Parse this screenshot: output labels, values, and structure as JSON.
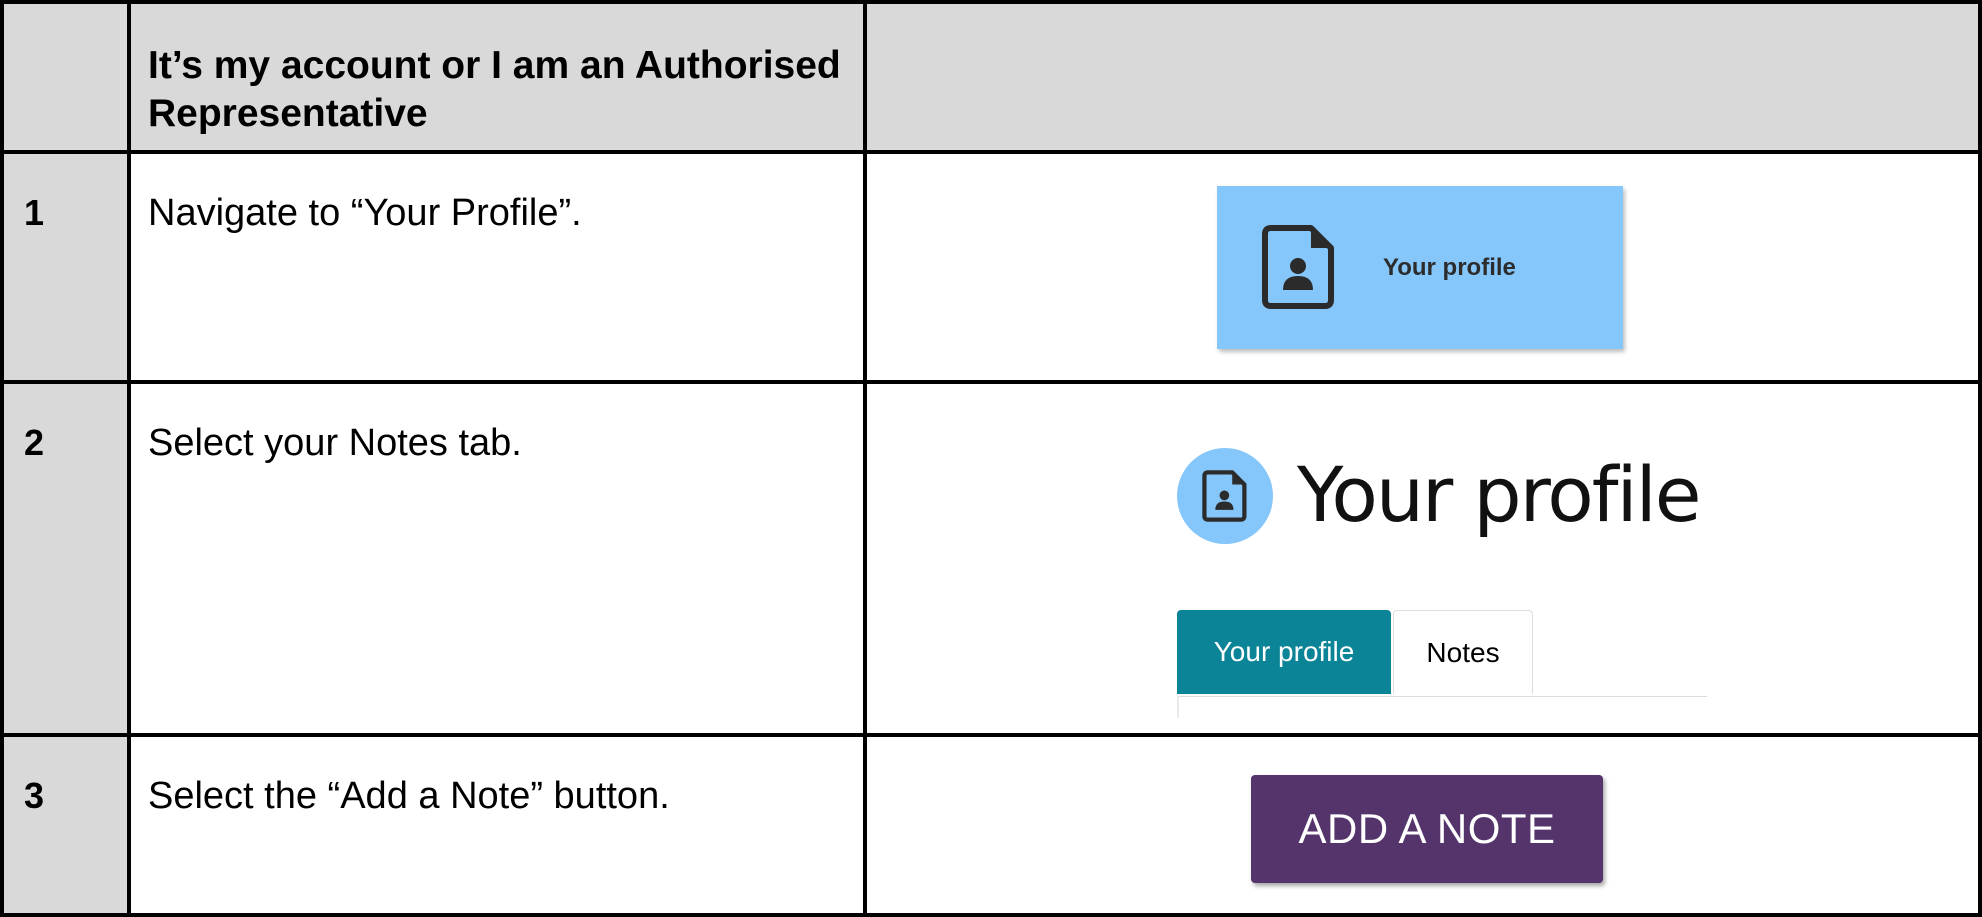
{
  "table": {
    "header": {
      "number": "",
      "instruction": "It’s my account or I am an Authorised Representative",
      "image": ""
    },
    "rows": [
      {
        "number": "1",
        "instruction": "Navigate to “Your Profile”.",
        "tile_label": "Your profile",
        "icon": "profile-document-icon"
      },
      {
        "number": "2",
        "instruction": "Select your Notes tab.",
        "page_title": "Your profile",
        "tabs": [
          "Your profile",
          "Notes"
        ],
        "active_tab": "Your profile",
        "icon": "profile-document-icon"
      },
      {
        "number": "3",
        "instruction": "Select the “Add a Note” button.",
        "button_label": "ADD A NOTE"
      }
    ]
  },
  "colors": {
    "header_gray": "#d9d9d9",
    "tile_blue": "#85c6fb",
    "tab_teal": "#0c8497",
    "button_purple": "#54346b"
  }
}
